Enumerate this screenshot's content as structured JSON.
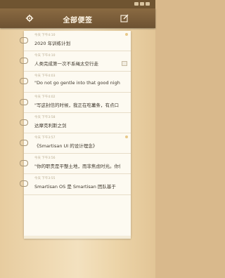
{
  "header": {
    "title": "全部便签"
  },
  "notes": [
    {
      "time": "今天 下午4:10",
      "text": "2020 年训练计划",
      "thumbnail": false
    },
    {
      "time": "今天 下午4:10",
      "text": "人类完成第一次不系绳太空行走",
      "thumbnail": true
    },
    {
      "time": "今天 下午4:03",
      "text": "\"Do not go gentle into that good night,",
      "thumbnail": false
    },
    {
      "time": "今天 下午4:02",
      "text": "\"写这封信的时候，我正在吃薯条，有点口",
      "thumbnail": false
    },
    {
      "time": "今天 下午3:58",
      "text": "达摩克利斯之剑",
      "thumbnail": false
    },
    {
      "time": "今天 下午3:57",
      "text": "《Smartisan UI 的设计理念》",
      "thumbnail": false
    },
    {
      "time": "今天 下午3:56",
      "text": "\"你的职责是平整土地，而非焦虑时光。你做",
      "thumbnail": false
    },
    {
      "time": "今天 下午3:55",
      "text": "Smartisan OS 是 Smartisan 团队基于",
      "thumbnail": false
    }
  ],
  "colors": {
    "titlebar": "#6d5232",
    "paper": "#fdfaf1",
    "ring": "#a89576"
  }
}
